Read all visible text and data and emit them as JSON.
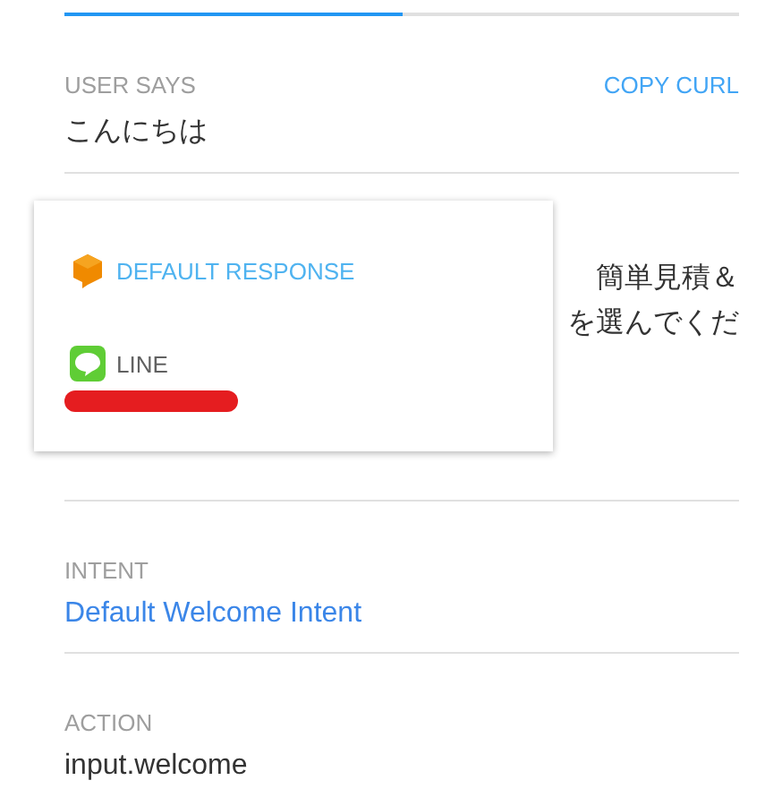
{
  "tab_indicator": {
    "level": 0.5
  },
  "user_says": {
    "label": "USER SAYS",
    "action": "COPY CURL",
    "value": "こんにちは"
  },
  "response": {
    "lines": [
      "簡単見積＆",
      "を選んでくだ"
    ]
  },
  "platform_menu": {
    "items": [
      {
        "kind": "default",
        "label": "DEFAULT RESPONSE",
        "selected": true
      },
      {
        "kind": "line",
        "label": "LINE",
        "selected": false,
        "redacted": true
      }
    ]
  },
  "intent": {
    "label": "INTENT",
    "value": "Default Welcome Intent"
  },
  "action": {
    "label": "ACTION",
    "value": "input.welcome"
  }
}
